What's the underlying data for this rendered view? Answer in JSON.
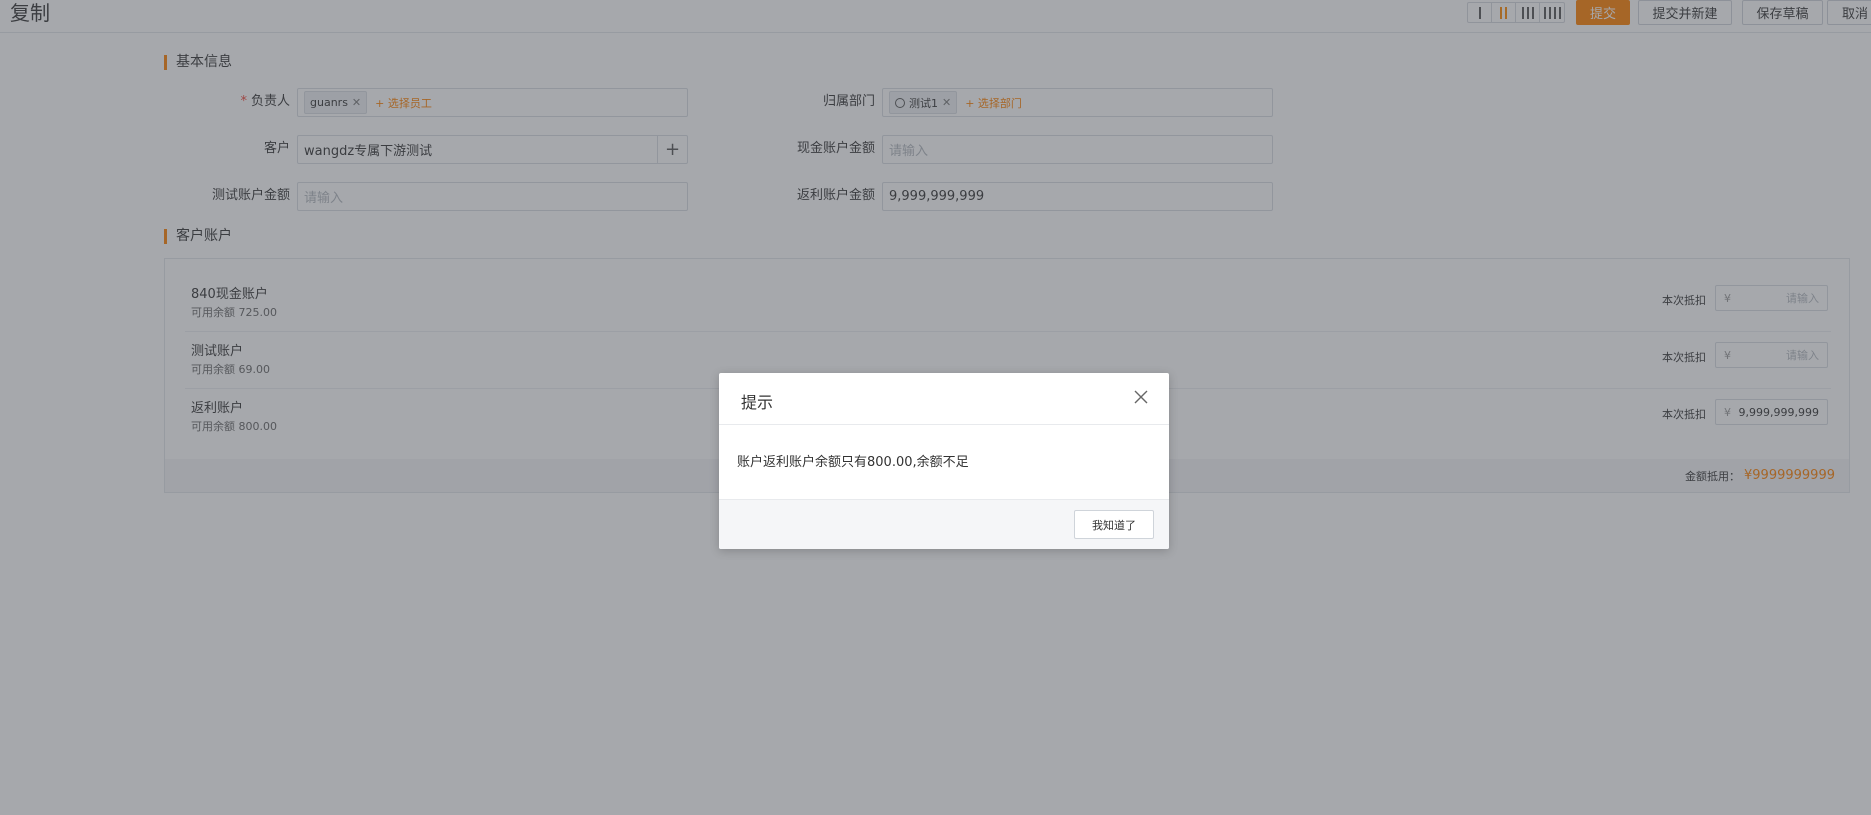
{
  "header": {
    "title": "复制",
    "buttons": {
      "submit": "提交",
      "submit_new": "提交并新建",
      "save_draft": "保存草稿",
      "cancel": "取消"
    }
  },
  "basic_info": {
    "title": "基本信息",
    "owner": {
      "label": "负责人",
      "tag": "guanrs",
      "add_link": "+ 选择员工"
    },
    "department": {
      "label": "归属部门",
      "tag": "测试1",
      "add_link": "+ 选择部门"
    },
    "customer": {
      "label": "客户",
      "value": "wangdz专属下游测试"
    },
    "cash_amount": {
      "label": "现金账户金额",
      "placeholder": "请输入"
    },
    "test_amount": {
      "label": "测试账户金额",
      "placeholder": "请输入"
    },
    "rebate_amount": {
      "label": "返利账户金额",
      "value": "9,999,999,999"
    }
  },
  "customer_accounts": {
    "title": "客户账户",
    "deduct_label": "本次抵扣",
    "currency": "¥",
    "placeholder": "请输入",
    "accounts": [
      {
        "name": "840现金账户",
        "balance": "可用余额 725.00",
        "value": ""
      },
      {
        "name": "测试账户",
        "balance": "可用余额 69.00",
        "value": ""
      },
      {
        "name": "返利账户",
        "balance": "可用余额 800.00",
        "value": "9,999,999,999"
      }
    ],
    "footer_label": "金额抵用：",
    "footer_amount": "¥9999999999"
  },
  "modal": {
    "title": "提示",
    "message": "账户返利账户余额只有800.00,余额不足",
    "ok_label": "我知道了"
  },
  "colors": {
    "accent": "#ff8000",
    "overlay": "rgba(70,74,82,0.48)"
  }
}
